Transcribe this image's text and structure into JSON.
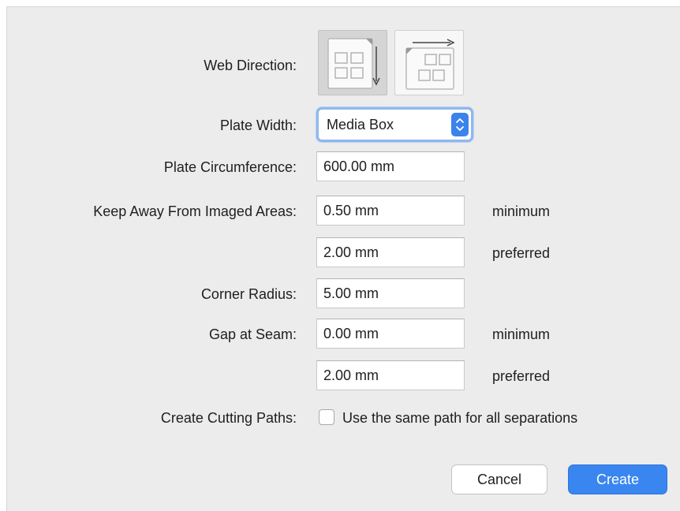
{
  "form": {
    "web_direction": {
      "label": "Web Direction:",
      "options": [
        {
          "icon": "web-direction-vertical-icon",
          "selected": true
        },
        {
          "icon": "web-direction-horizontal-icon",
          "selected": false
        }
      ]
    },
    "plate_width": {
      "label": "Plate Width:",
      "value": "Media Box",
      "icon": "updown-chevron-icon"
    },
    "plate_circumference": {
      "label": "Plate Circumference:",
      "value": "600.00 mm"
    },
    "keep_away": {
      "label": "Keep Away From Imaged Areas:",
      "minimum": "0.50 mm",
      "minimum_note": "minimum",
      "preferred": "2.00 mm",
      "preferred_note": "preferred"
    },
    "corner_radius": {
      "label": "Corner Radius:",
      "value": "5.00 mm"
    },
    "gap_at_seam": {
      "label": "Gap at Seam:",
      "minimum": "0.00 mm",
      "minimum_note": "minimum",
      "preferred": "2.00 mm",
      "preferred_note": "preferred"
    },
    "cutting_paths": {
      "label": "Create Cutting Paths:",
      "checkbox_label": "Use the same path for all separations",
      "checked": false
    }
  },
  "buttons": {
    "cancel": "Cancel",
    "create": "Create"
  },
  "colors": {
    "accent": "#3a86f0",
    "focus_ring": "#8fb8ee",
    "dialog_bg": "#ececec"
  }
}
